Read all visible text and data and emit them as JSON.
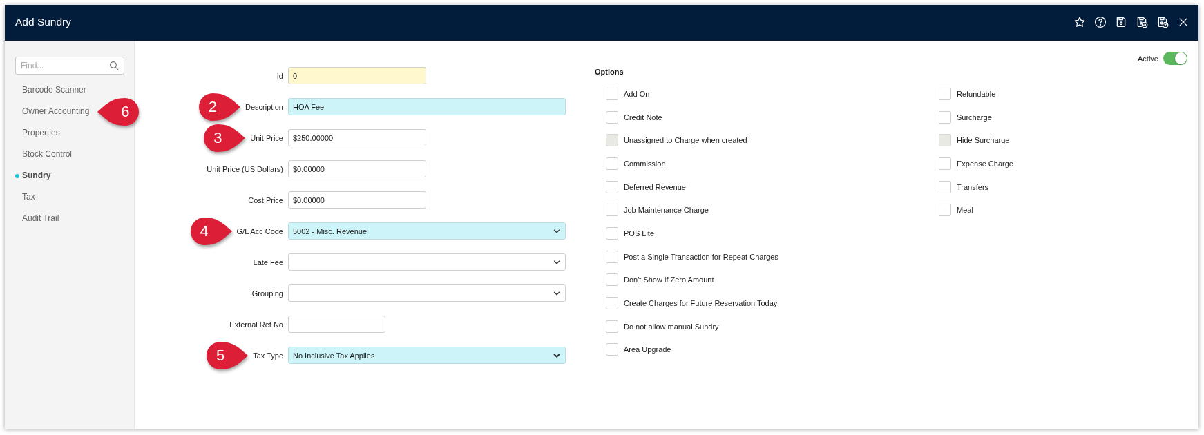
{
  "window": {
    "title": "Add Sundry"
  },
  "sidebar": {
    "search": {
      "placeholder": "Find..."
    },
    "items": [
      {
        "label": "Barcode Scanner",
        "selected": false
      },
      {
        "label": "Owner Accounting",
        "selected": false,
        "callout": "6"
      },
      {
        "label": "Properties",
        "selected": false
      },
      {
        "label": "Stock Control",
        "selected": false
      },
      {
        "label": "Sundry",
        "selected": true
      },
      {
        "label": "Tax",
        "selected": false
      },
      {
        "label": "Audit Trail",
        "selected": false
      }
    ]
  },
  "active_toggle": {
    "label": "Active",
    "on": true
  },
  "form": {
    "fields": [
      {
        "label": "Id",
        "kind": "text",
        "value": "0",
        "read_only": true,
        "required": false
      },
      {
        "label": "Description",
        "kind": "text",
        "value": "HOA Fee",
        "read_only": false,
        "required": true,
        "callout": "2"
      },
      {
        "label": "Unit Price",
        "kind": "text",
        "value": "$250.00000",
        "read_only": false,
        "required": false,
        "callout": "3"
      },
      {
        "label": "Unit Price (US Dollars)",
        "kind": "text",
        "value": "$0.00000",
        "read_only": false,
        "required": false
      },
      {
        "label": "Cost Price",
        "kind": "text",
        "value": "$0.00000",
        "read_only": false,
        "required": false
      },
      {
        "label": "G/L Acc Code",
        "kind": "select",
        "value": "5002 - Misc. Revenue",
        "read_only": false,
        "required": true,
        "callout": "4"
      },
      {
        "label": "Late Fee",
        "kind": "select",
        "read_only": false,
        "required": false
      },
      {
        "label": "Grouping",
        "kind": "select",
        "read_only": false,
        "required": false
      },
      {
        "label": "External Ref No",
        "kind": "text",
        "read_only": false,
        "required": false
      },
      {
        "label": "Tax Type",
        "kind": "select",
        "value": "No Inclusive Tax Applies",
        "read_only": false,
        "required": true,
        "callout": "5"
      }
    ]
  },
  "options": {
    "title": "Options",
    "columns": [
      [
        {
          "label": "Add On",
          "checked": false,
          "disabled": false
        },
        {
          "label": "Credit Note",
          "checked": false,
          "disabled": false
        },
        {
          "label": "Unassigned to Charge when created",
          "checked": false,
          "disabled": true
        },
        {
          "label": "Commission",
          "checked": false,
          "disabled": false
        },
        {
          "label": "Deferred Revenue",
          "checked": false,
          "disabled": false
        },
        {
          "label": "Job Maintenance Charge",
          "checked": false,
          "disabled": false
        },
        {
          "label": "POS Lite",
          "checked": false,
          "disabled": false
        },
        {
          "label": "Post a Single Transaction for Repeat Charges",
          "checked": false,
          "disabled": false
        },
        {
          "label": "Don't Show if Zero Amount",
          "checked": false,
          "disabled": false
        },
        {
          "label": "Create Charges for Future Reservation Today",
          "checked": false,
          "disabled": false
        },
        {
          "label": "Do not allow manual Sundry",
          "checked": false,
          "disabled": false
        },
        {
          "label": "Area Upgrade",
          "checked": false,
          "disabled": false
        }
      ],
      [
        {
          "label": "Refundable",
          "checked": false,
          "disabled": false
        },
        {
          "label": "Surcharge",
          "checked": false,
          "disabled": false
        },
        {
          "label": "Hide Surcharge",
          "checked": false,
          "disabled": true
        },
        {
          "label": "Expense Charge",
          "checked": false,
          "disabled": false
        },
        {
          "label": "Transfers",
          "checked": false,
          "disabled": false
        },
        {
          "label": "Meal",
          "checked": false,
          "disabled": false
        }
      ]
    ]
  }
}
